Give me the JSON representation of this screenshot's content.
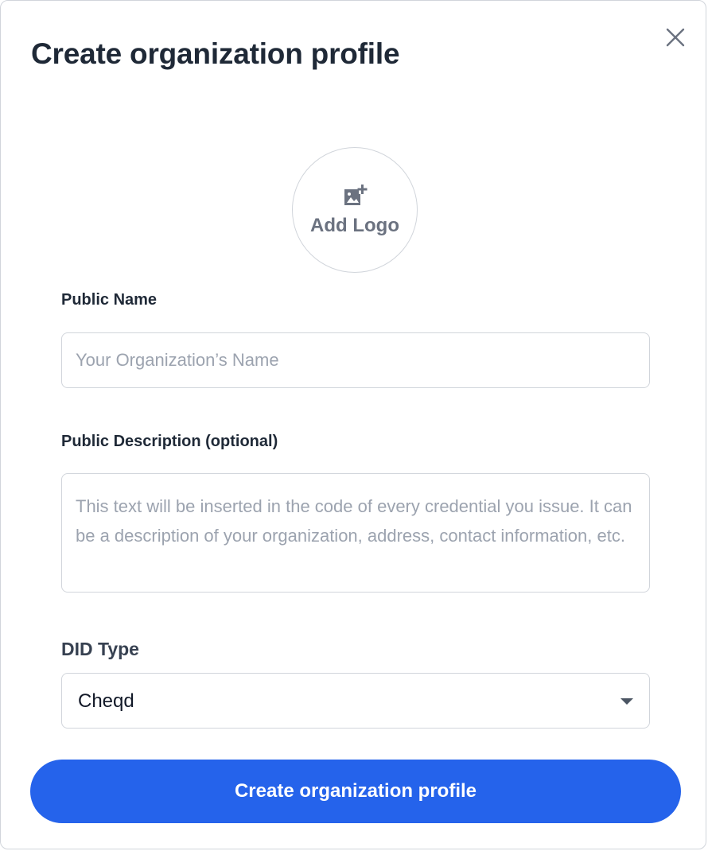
{
  "modal": {
    "title": "Create organization profile",
    "close_icon": "close-icon"
  },
  "logo_upload": {
    "icon": "add-image-icon",
    "label": "Add Logo"
  },
  "public_name": {
    "label": "Public Name",
    "placeholder": "Your Organization’s Name",
    "value": ""
  },
  "public_description": {
    "label": "Public Description (optional)",
    "placeholder": "This text will be inserted in the code of every credential you issue. It can be a description of your organization, address, contact information, etc.",
    "value": ""
  },
  "did_type": {
    "label": "DID Type",
    "selected": "Cheqd",
    "icon": "chevron-down-icon"
  },
  "submit": {
    "label": "Create organization profile"
  },
  "colors": {
    "primary": "#2563eb",
    "title_text": "#1f2937",
    "placeholder": "#9ca3af",
    "border": "#d1d5db"
  }
}
